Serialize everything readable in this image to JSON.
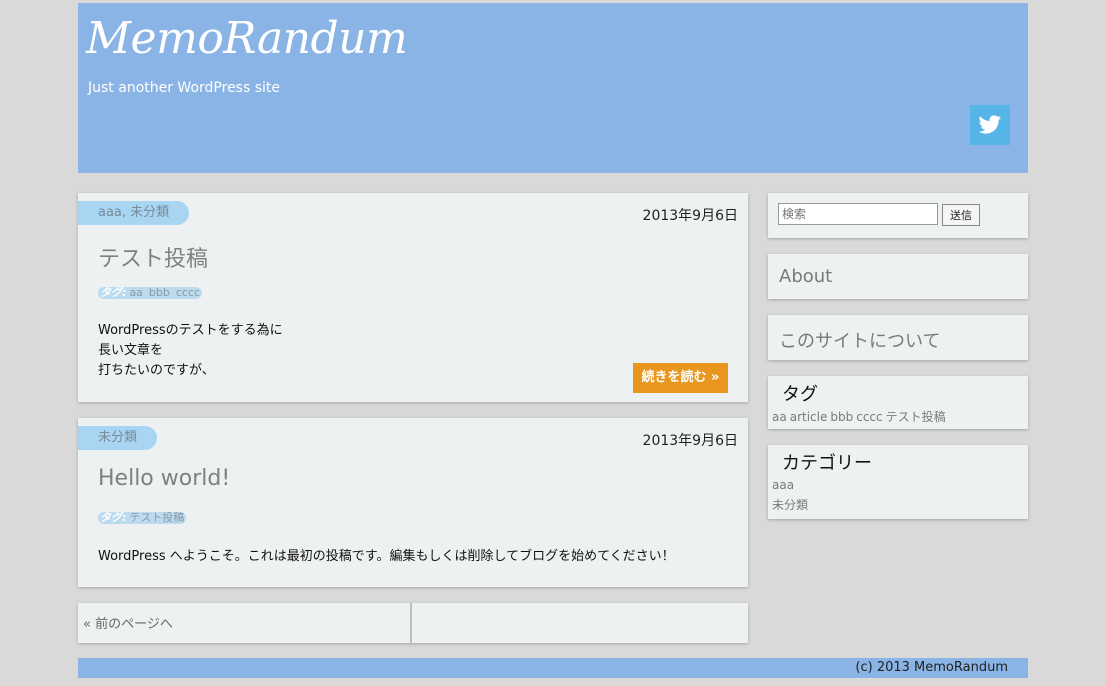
{
  "site": {
    "title": "MemoRandum",
    "tagline": "Just another WordPress site"
  },
  "icons": {
    "twitter": "twitter-bird-icon"
  },
  "colors": {
    "header_bg": "#8ab4e6",
    "twitter_bg": "#55b5e6",
    "readmore_bg": "#e8961e",
    "category_pill": "#a8d5f2"
  },
  "posts": [
    {
      "categories": [
        "aaa",
        "未分類"
      ],
      "category_sep": ", ",
      "date": "2013年9月6日",
      "title": "テスト投稿",
      "tags_label": "タグ:",
      "tags": [
        "aa",
        "bbb",
        "cccc"
      ],
      "excerpt": [
        "WordPressのテストをする為に",
        "長い文章を",
        "打ちたいのですが、"
      ],
      "read_more": "続きを読む »"
    },
    {
      "categories": [
        "未分類"
      ],
      "date": "2013年9月6日",
      "title": "Hello world!",
      "tags_label": "タグ:",
      "tags": [
        "テスト投稿"
      ],
      "excerpt": [
        "WordPress へようこそ。これは最初の投稿です。編集もしくは削除してブログを始めてください！"
      ]
    }
  ],
  "pager": {
    "prev": "« 前のページへ"
  },
  "sidebar": {
    "search": {
      "placeholder": "検索",
      "button": "送信"
    },
    "pages": [
      "About",
      "このサイトについて"
    ],
    "tags_widget": {
      "title": "タグ",
      "tags": [
        "aa",
        "article",
        "bbb",
        "cccc",
        "テスト投稿"
      ]
    },
    "categories_widget": {
      "title": "カテゴリー",
      "items": [
        "aaa",
        "未分類"
      ]
    }
  },
  "footer": {
    "copyright": "(c) 2013 MemoRandum"
  }
}
